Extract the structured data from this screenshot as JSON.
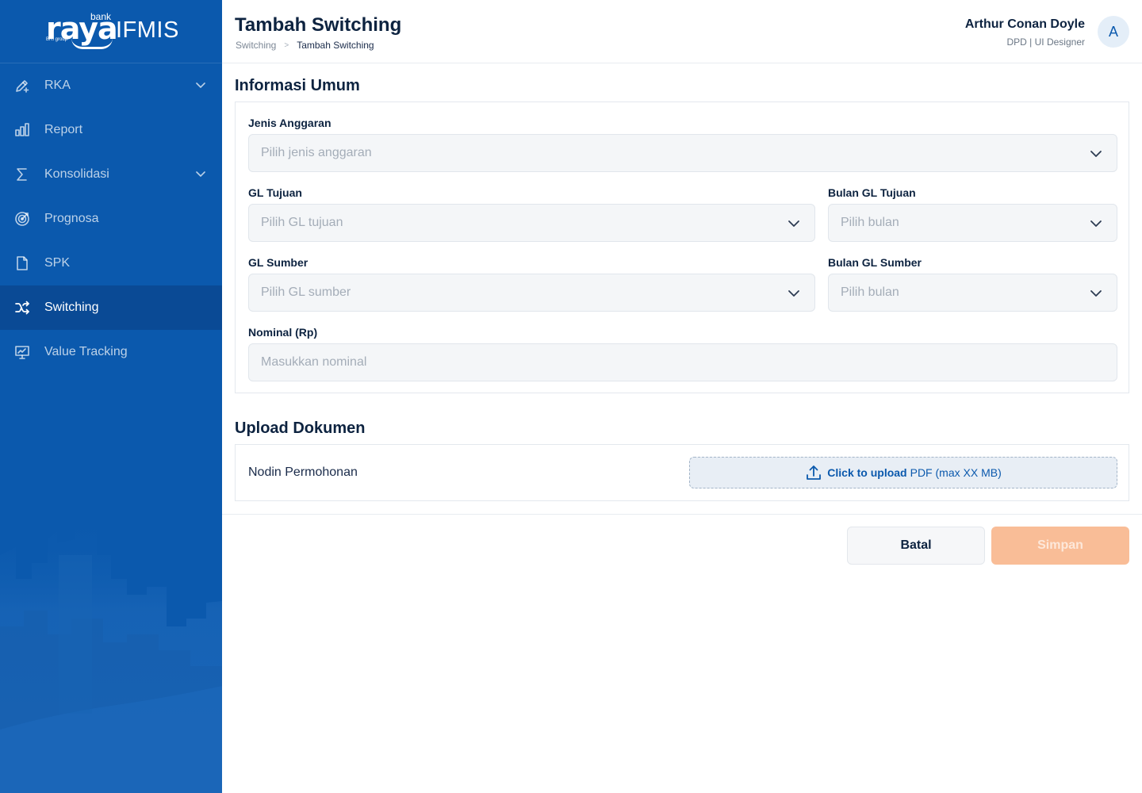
{
  "brand": {
    "bank": "bank",
    "raya": "raya",
    "bri": "BRI group",
    "ifmis": "IFMIS"
  },
  "sidebar": {
    "items": [
      {
        "label": "RKA",
        "icon": "pencil-plus-icon",
        "expandable": true
      },
      {
        "label": "Report",
        "icon": "bar-chart-icon",
        "expandable": false
      },
      {
        "label": "Konsolidasi",
        "icon": "sigma-icon",
        "expandable": true
      },
      {
        "label": "Prognosa",
        "icon": "target-icon",
        "expandable": false
      },
      {
        "label": "SPK",
        "icon": "document-icon",
        "expandable": false
      },
      {
        "label": "Switching",
        "icon": "shuffle-icon",
        "expandable": false,
        "active": true
      },
      {
        "label": "Value Tracking",
        "icon": "monitor-chart-icon",
        "expandable": false
      }
    ]
  },
  "header": {
    "title": "Tambah Switching",
    "breadcrumb": [
      "Switching",
      "Tambah Switching"
    ],
    "breadcrumb_separator": ">",
    "user": {
      "name": "Arthur Conan Doyle",
      "role": "DPD | UI Designer",
      "initial": "A"
    }
  },
  "info": {
    "title": "Informasi Umum",
    "jenis_anggaran": {
      "label": "Jenis Anggaran",
      "placeholder": "Pilih jenis anggaran"
    },
    "gl_tujuan": {
      "label": "GL Tujuan",
      "placeholder": "Pilih GL tujuan"
    },
    "bulan_gl_tujuan": {
      "label": "Bulan GL Tujuan",
      "placeholder": "Pilih bulan"
    },
    "gl_sumber": {
      "label": "GL Sumber",
      "placeholder": "Pilih GL sumber"
    },
    "bulan_gl_sumber": {
      "label": "Bulan GL Sumber",
      "placeholder": "Pilih bulan"
    },
    "nominal": {
      "label": "Nominal (Rp)",
      "placeholder": "Masukkan nominal"
    }
  },
  "upload": {
    "title": "Upload Dokumen",
    "item_label": "Nodin Permohonan",
    "cta": "Click to upload",
    "hint": "PDF (max XX MB)"
  },
  "actions": {
    "cancel": "Batal",
    "save": "Simpan"
  },
  "colors": {
    "sidebar": "#0b59ad",
    "sidebar_active": "#0a4a95",
    "primary_text": "#0d2340",
    "save_disabled": "#f9bd97"
  }
}
